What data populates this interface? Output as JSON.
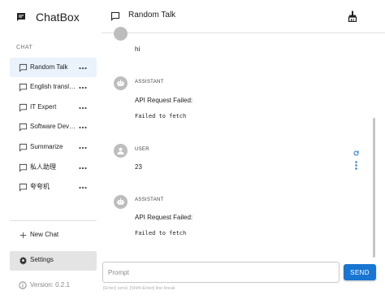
{
  "app": {
    "title": "ChatBox",
    "icon": "chat-bubble-icon"
  },
  "colors": {
    "accent": "#1976d2",
    "active_item_bg": "#eaf3fb",
    "settings_bg": "#e4e4e4",
    "avatar_bg": "#bdbdbd"
  },
  "sidebar": {
    "section_label": "CHAT",
    "items": [
      {
        "label": "Random Talk",
        "icon": "chat-outline-icon",
        "active": true
      },
      {
        "label": "English translator",
        "icon": "chat-outline-icon",
        "active": false
      },
      {
        "label": "IT Expert",
        "icon": "chat-outline-icon",
        "active": false
      },
      {
        "label": "Software Developer",
        "icon": "chat-outline-icon",
        "active": false
      },
      {
        "label": "Summarize",
        "icon": "chat-outline-icon",
        "active": false
      },
      {
        "label": "私人助理",
        "icon": "chat-outline-icon",
        "active": false
      },
      {
        "label": "夸夸机",
        "icon": "chat-outline-icon",
        "active": false
      }
    ],
    "more_icon": "more-horizontal-icon",
    "new_chat_label": "New Chat",
    "settings_label": "Settings",
    "version_label": "Version: 0.2.1"
  },
  "header": {
    "title": "Random Talk",
    "chat_icon": "chat-icon",
    "action_icon": "clean-brush-icon"
  },
  "messages": [
    {
      "role": "",
      "text": "hi",
      "detail": ""
    },
    {
      "role": "ASSISTANT",
      "text": "API Request Failed:",
      "detail": "Failed to fetch"
    },
    {
      "role": "USER",
      "text": "23",
      "detail": ""
    },
    {
      "role": "ASSISTANT",
      "text": "API Request Failed:",
      "detail": "Failed to fetch"
    }
  ],
  "input": {
    "placeholder": "Prompt",
    "value": "",
    "send_label": "SEND",
    "hint": "[Enter] send, [Shift+Enter] line break"
  }
}
